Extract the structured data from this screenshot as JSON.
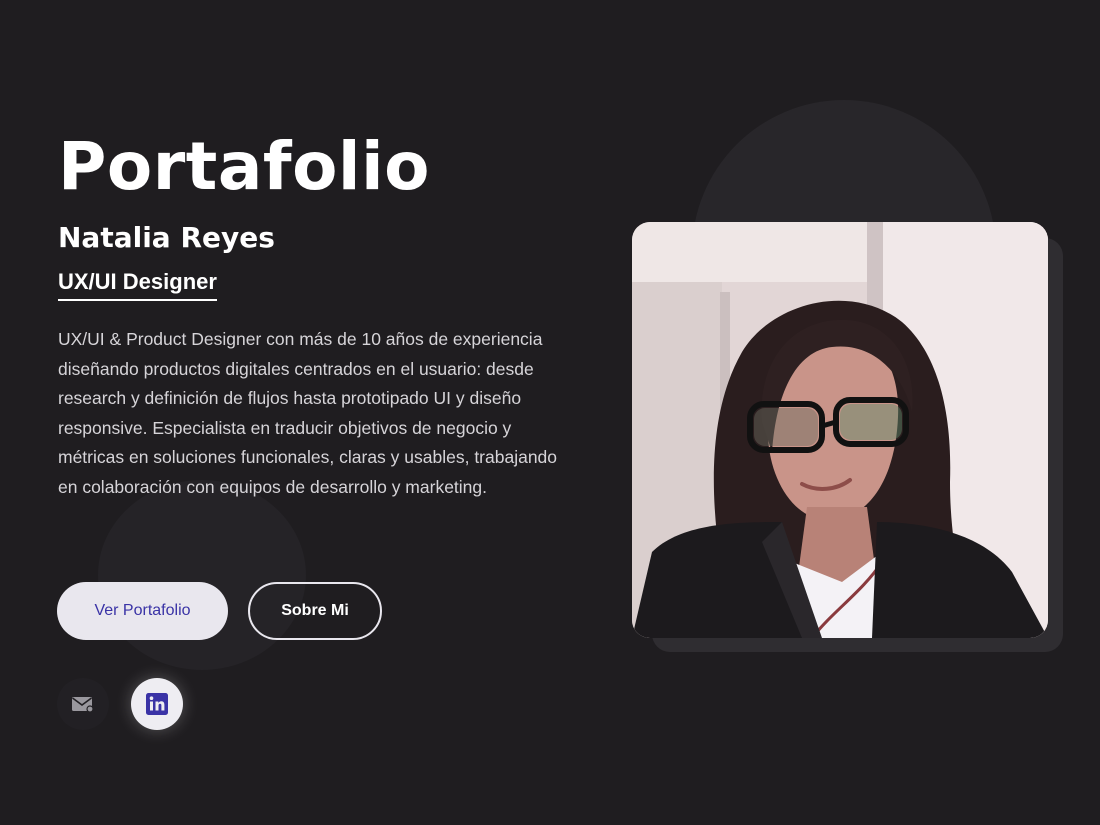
{
  "hero": {
    "title": "Portafolio",
    "name": "Natalia Reyes",
    "role": "UX/UI Designer",
    "bio": "UX/UI & Product Designer con más de 10 años de experiencia diseñando productos digitales centrados en el usuario: desde research y definición de flujos hasta prototipado UI y diseño responsive. Especialista en traducir objetivos de negocio y métricas en soluciones funcionales, claras y usables, trabajando en colaboración con equipos de desarrollo y marketing."
  },
  "buttons": {
    "primary_label": "Ver Portafolio",
    "secondary_label": "Sobre Mi"
  },
  "socials": [
    {
      "icon": "mail-icon"
    },
    {
      "icon": "linkedin-icon"
    }
  ],
  "colors": {
    "background": "#1f1d20",
    "accent": "#3a33a6",
    "button_light": "#e9e7ee"
  }
}
